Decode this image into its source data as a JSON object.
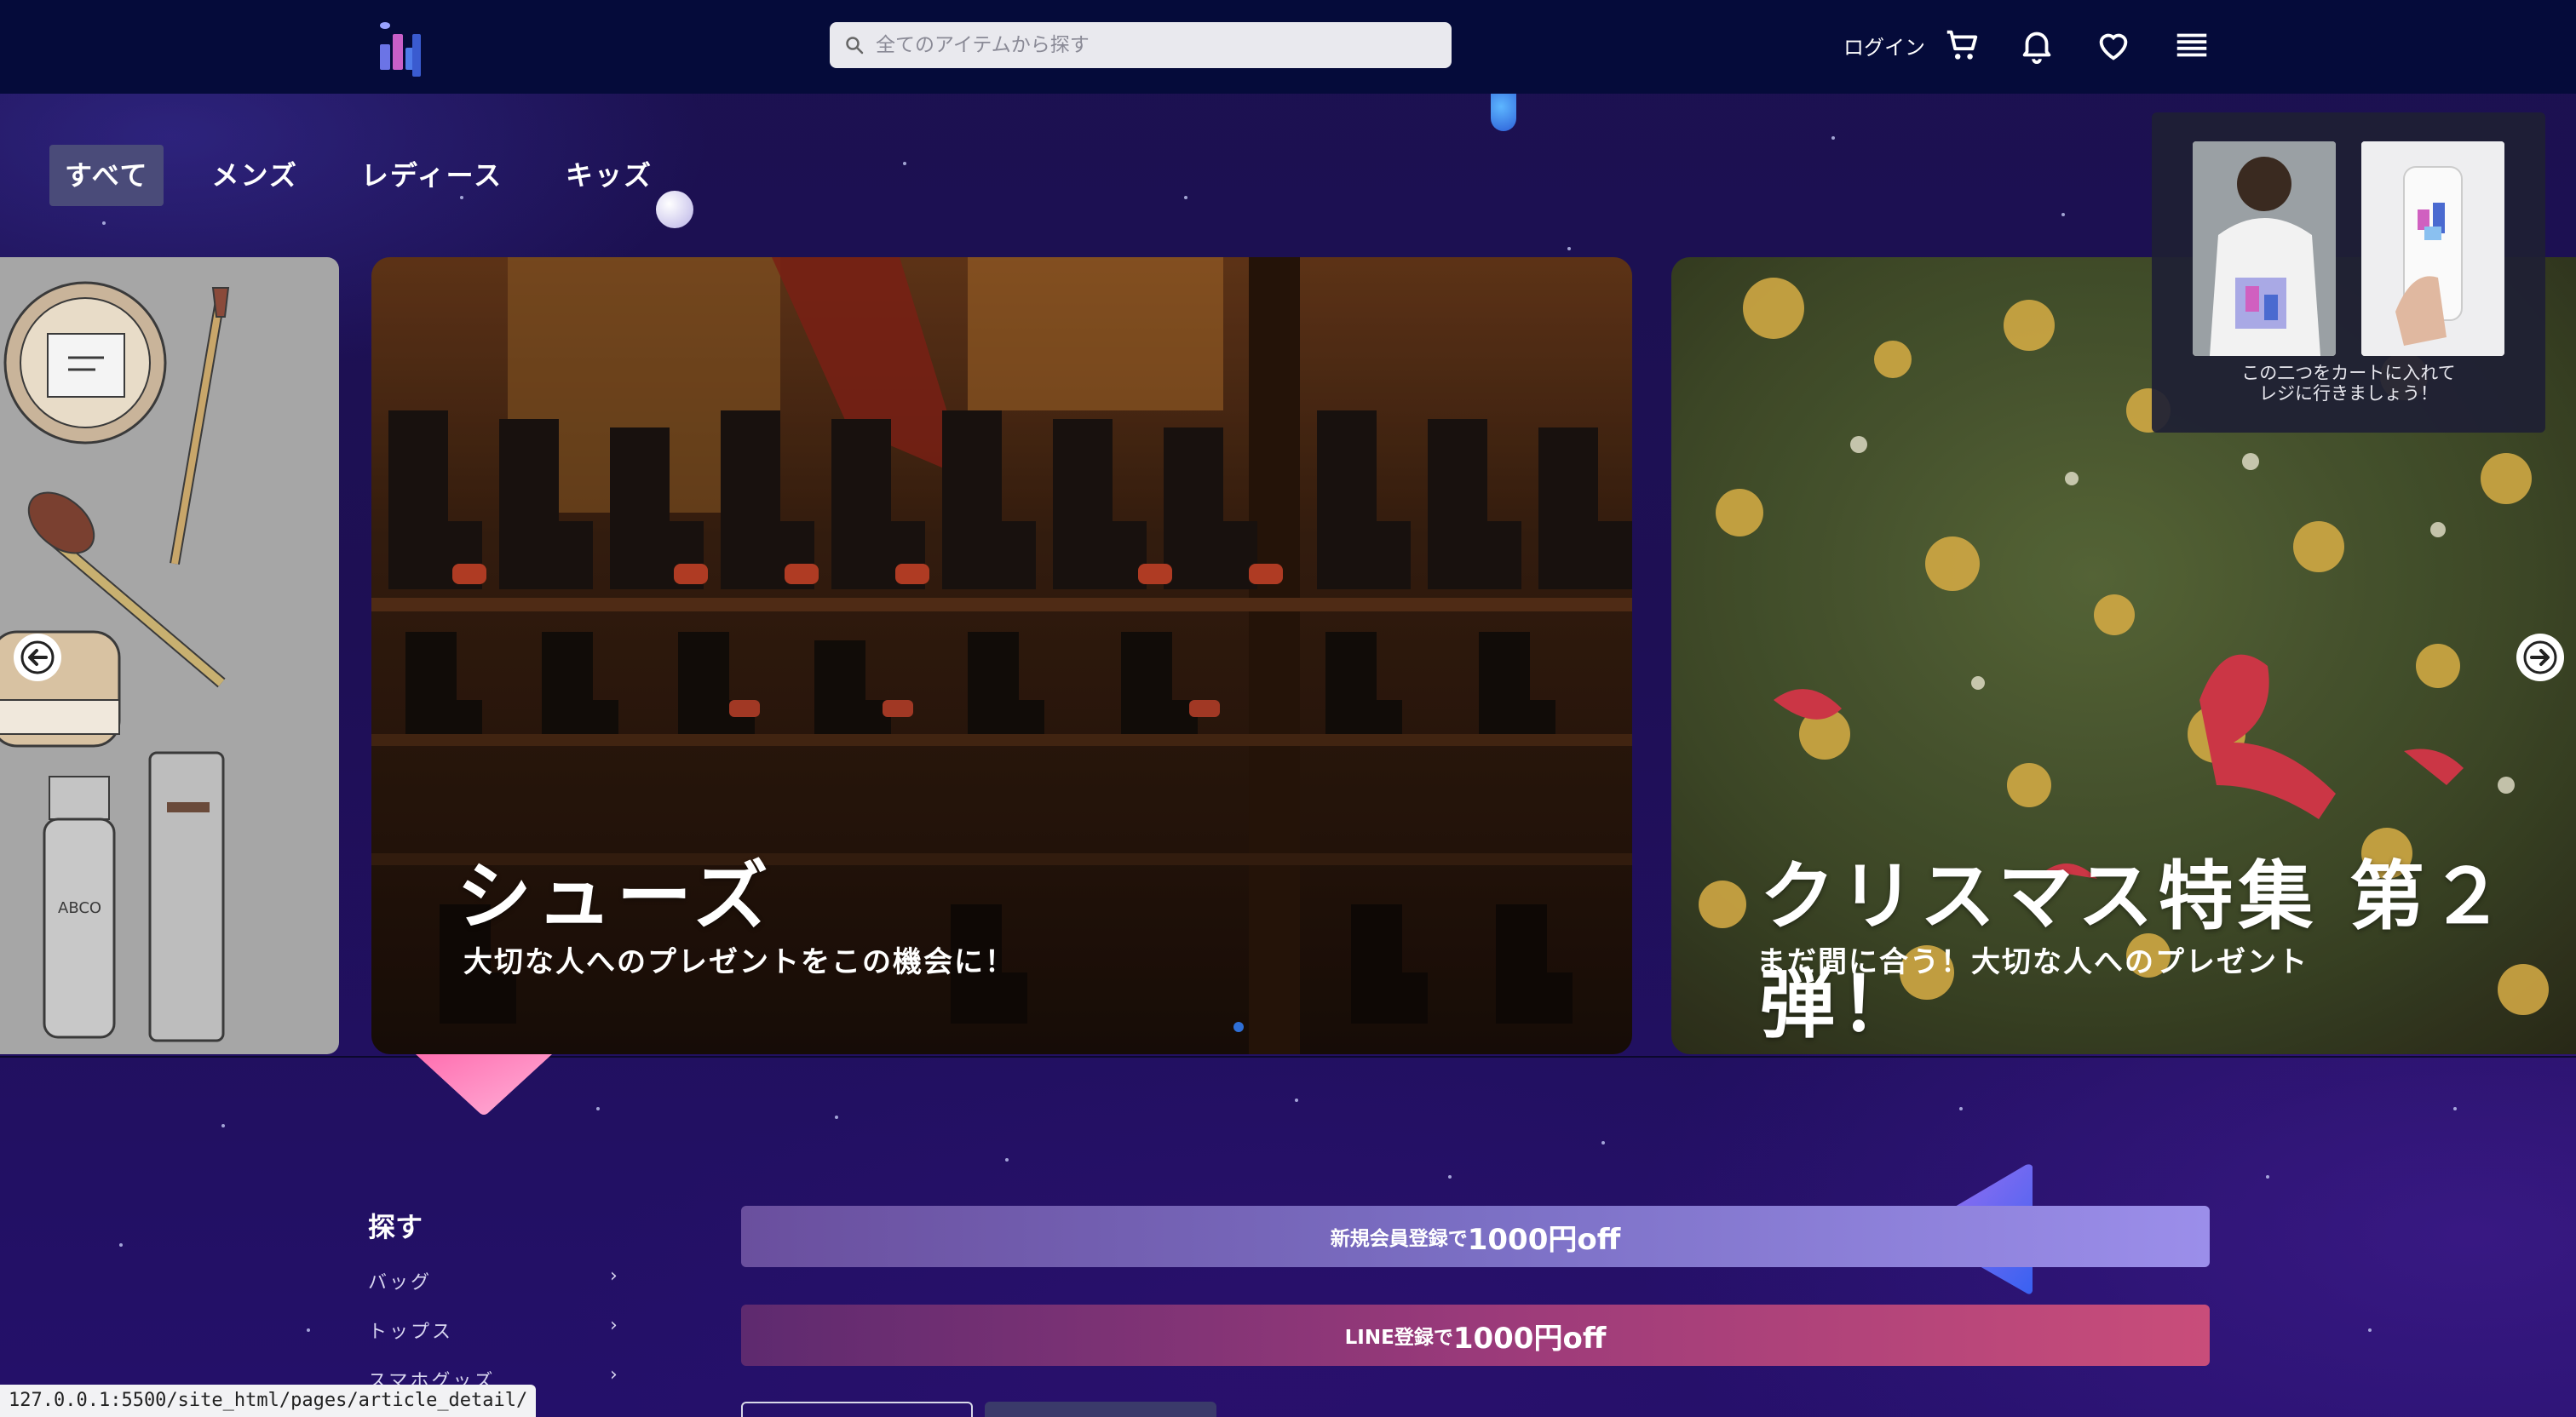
{
  "header": {
    "search_placeholder": "全てのアイテムから探す",
    "login_label": "ログイン"
  },
  "tabs": [
    "すべて",
    "メンズ",
    "レディース",
    "キッズ"
  ],
  "slides": [
    {
      "title": "シューズ",
      "subtitle": "大切な人へのプレゼントをこの機会に！"
    },
    {
      "title": "クリスマス特集 第２弾！",
      "subtitle": "まだ間に合う！大切な人へのプレゼント"
    }
  ],
  "cart_popup": {
    "caption_line1": "この二つをカートに入れて",
    "caption_line2": "レジに行きましょう！"
  },
  "find": {
    "title": "探す",
    "items": [
      "バッグ",
      "トップス",
      "スマホグッズ"
    ]
  },
  "promos": [
    {
      "small": "新規会員登録で",
      "big": "1000円off"
    },
    {
      "small": "LINE登録で",
      "big": "1000円off"
    }
  ],
  "status_url": "127.0.0.1:5500/site_html/pages/article_detail/",
  "colors": {
    "header_bg": "#050b3a",
    "page_bg": "#1e0f55",
    "active_tab": "#4a4b79",
    "promo1": "#7b6fc4",
    "promo2": "#b8446f"
  }
}
